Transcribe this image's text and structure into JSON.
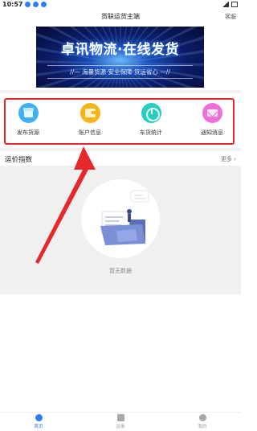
{
  "status": {
    "time": "10:57"
  },
  "header": {
    "title": "货联运货主端",
    "action": "客服"
  },
  "banner": {
    "title": "卓讯物流·在线发货",
    "subtitle": "//— 海量货源·安全保障·货运省心 —//"
  },
  "quick_menu": {
    "items": [
      {
        "label": "发布货源",
        "icon": "box-icon",
        "color": "#3fb1f3"
      },
      {
        "label": "账户信息",
        "icon": "wallet-icon",
        "color": "#f9b318"
      },
      {
        "label": "车货统计",
        "icon": "chart-icon",
        "color": "#27cdbe"
      },
      {
        "label": "通知消息",
        "icon": "mail-icon",
        "color": "#ef6fd8"
      }
    ]
  },
  "freight_index": {
    "title": "运价指数",
    "more": "更多 ›",
    "empty_text": "暂无数据"
  },
  "tabbar": {
    "items": [
      {
        "label": "首页",
        "active": true
      },
      {
        "label": "运单",
        "active": false
      },
      {
        "label": "我的",
        "active": false
      }
    ]
  },
  "colors": {
    "accent": "#2f7df6",
    "highlight": "#e5282a",
    "inactive": "#9a9a9a"
  }
}
